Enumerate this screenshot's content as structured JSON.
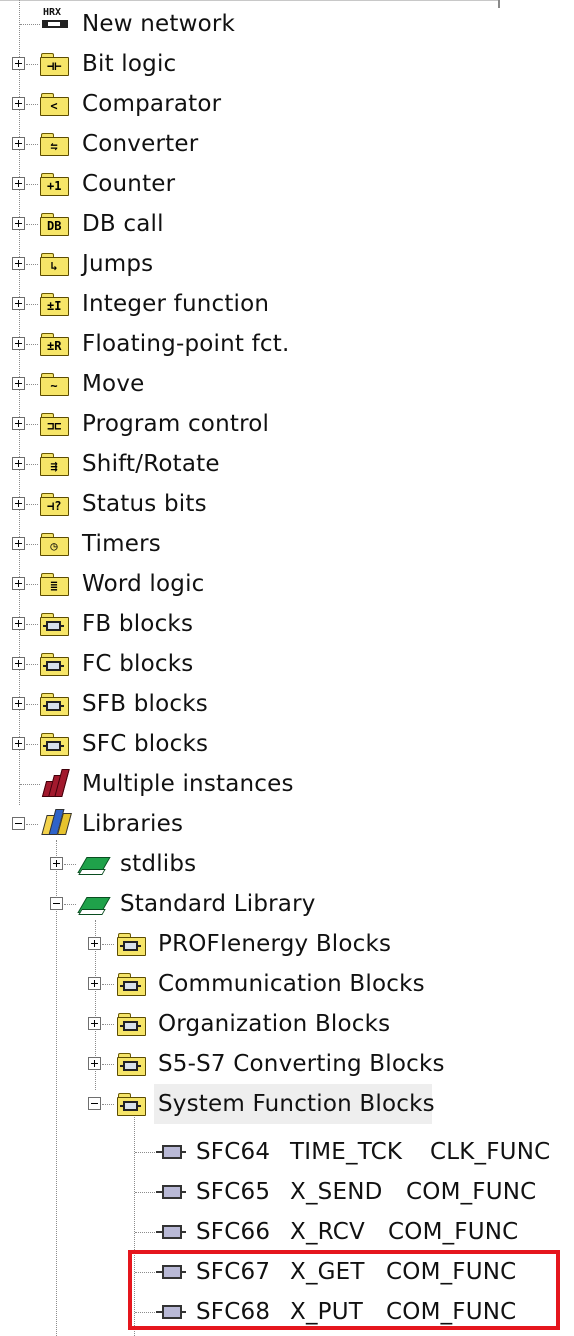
{
  "tree": {
    "new_network": "New network",
    "bit_logic": "Bit logic",
    "comparator": "Comparator",
    "converter": "Converter",
    "counter": "Counter",
    "db_call": "DB call",
    "jumps": "Jumps",
    "integer_function": "Integer function",
    "floating_point": "Floating-point fct.",
    "move": "Move",
    "program_control": "Program control",
    "shift_rotate": "Shift/Rotate",
    "status_bits": "Status bits",
    "timers": "Timers",
    "word_logic": "Word logic",
    "fb_blocks": "FB blocks",
    "fc_blocks": "FC blocks",
    "sfb_blocks": "SFB blocks",
    "sfc_blocks": "SFC blocks",
    "multiple_instances": "Multiple instances",
    "libraries": "Libraries",
    "stdlibs": "stdlibs",
    "standard_library": "Standard Library",
    "profienergy": "PROFIenergy Blocks",
    "communication": "Communication Blocks",
    "organization": "Organization Blocks",
    "s5s7": "S5-S7 Converting Blocks",
    "system_function": "System Function Blocks"
  },
  "icons": {
    "network_glyph": "HRX",
    "bit_logic_glyph": "⊣⊢",
    "comparator_glyph": "<",
    "converter_glyph": "⇋",
    "counter_glyph": "+1",
    "db_glyph": "DB",
    "jumps_glyph": "↳",
    "integer_glyph": "±I",
    "float_glyph": "±R",
    "move_glyph": "~",
    "program_glyph": "⊐⊏",
    "shift_glyph": "⇶",
    "status_glyph": "⊣?",
    "timers_glyph": "◷",
    "word_glyph": "≣"
  },
  "sfc_items": [
    {
      "num": "SFC64",
      "name": "TIME_TCK",
      "family": "CLK_FUNC"
    },
    {
      "num": "SFC65",
      "name": "X_SEND",
      "family": "COM_FUNC"
    },
    {
      "num": "SFC66",
      "name": "X_RCV",
      "family": "COM_FUNC"
    },
    {
      "num": "SFC67",
      "name": "X_GET",
      "family": "COM_FUNC"
    },
    {
      "num": "SFC68",
      "name": "X_PUT",
      "family": "COM_FUNC"
    }
  ],
  "colors": {
    "highlight": "#e5161d",
    "folder": "#f6e568",
    "book": "#1fa24a"
  }
}
